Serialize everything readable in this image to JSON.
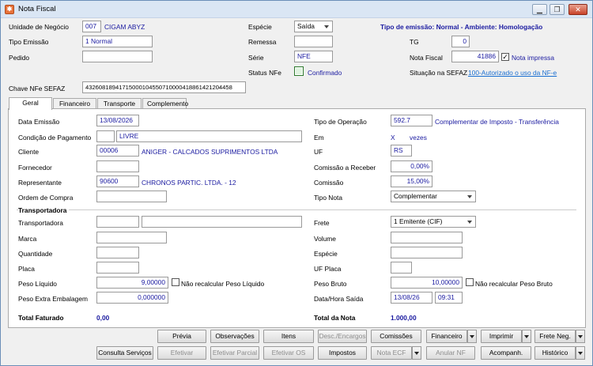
{
  "window": {
    "title": "Nota Fiscal",
    "icon": "app-icon",
    "controls": [
      "minimize",
      "restore",
      "close"
    ]
  },
  "header": {
    "unidade_label": "Unidade de Negócio",
    "unidade_code": "007",
    "unidade_name": "CIGAM ABYZ",
    "especie_label": "Espécie",
    "especie_value": "Saída",
    "tipo_emissao_banner": "Tipo de emissão: Normal - Ambiente: Homologação",
    "tipo_emissao_label": "Tipo Emissão",
    "tipo_emissao_value": "1 Normal",
    "remessa_label": "Remessa",
    "remessa_value": "",
    "tg_label": "TG",
    "tg_value": "0",
    "pedido_label": "Pedido",
    "pedido_value": "",
    "serie_label": "Série",
    "serie_value": "NFE",
    "nota_fiscal_label": "Nota Fiscal",
    "nota_fiscal_value": "41886",
    "nota_impressa_label": "Nota impressa",
    "nota_impressa_checked": true,
    "status_nfe_label": "Status NFe",
    "status_nfe_value": "Confirmado",
    "status_color": "#2e9a2e",
    "situacao_label": "Situação na SEFAZ",
    "situacao_value": "100-Autorizado o uso da NF-e",
    "chave_label": "Chave NFe SEFAZ",
    "chave_value": "43260818941715000104550710000418861421204458"
  },
  "tabs": [
    {
      "label": "Geral",
      "active": true
    },
    {
      "label": "Financeiro",
      "active": false
    },
    {
      "label": "Transporte",
      "active": false
    },
    {
      "label": "Complemento",
      "active": false
    }
  ],
  "geral": {
    "data_emissao_label": "Data Emissão",
    "data_emissao_value": "13/08/2026",
    "tipo_operacao_label": "Tipo de Operação",
    "tipo_operacao_code": "592.7",
    "tipo_operacao_desc": "Complementar de Imposto - Transferência",
    "cond_pag_label": "Condição de Pagamento",
    "cond_pag_code": "",
    "cond_pag_value": "LIVRE",
    "em_label": "Em",
    "em_x": "X",
    "em_vezes": "vezes",
    "cliente_label": "Cliente",
    "cliente_code": "00006",
    "cliente_name": "ANIGER - CALCADOS SUPRIMENTOS LTDA",
    "uf_label": "UF",
    "uf_value": "RS",
    "fornecedor_label": "Fornecedor",
    "fornecedor_value": "",
    "comissao_receber_label": "Comissão a Receber",
    "comissao_receber_value": "0,00%",
    "representante_label": "Representante",
    "representante_code": "90600",
    "representante_name": "CHRONOS PARTIC. LTDA. - 12",
    "comissao_label": "Comissão",
    "comissao_value": "15,00%",
    "ordem_compra_label": "Ordem de Compra",
    "ordem_compra_value": "",
    "tipo_nota_label": "Tipo Nota",
    "tipo_nota_value": "Complementar"
  },
  "transporte": {
    "section_label": "Transportadora",
    "transportadora_label": "Transportadora",
    "transportadora_code": "",
    "transportadora_name": "",
    "frete_label": "Frete",
    "frete_value": "1 Emitente (CIF)",
    "marca_label": "Marca",
    "marca_value": "",
    "volume_label": "Volume",
    "volume_value": "",
    "quantidade_label": "Quantidade",
    "quantidade_value": "",
    "especie_label": "Espécie",
    "especie_value": "",
    "placa_label": "Placa",
    "placa_value": "",
    "uf_placa_label": "UF Placa",
    "uf_placa_value": "",
    "peso_liquido_label": "Peso Líquido",
    "peso_liquido_value": "9,00000",
    "nao_recalc_liq_label": "Não recalcular Peso Líquido",
    "peso_bruto_label": "Peso Bruto",
    "peso_bruto_value": "10,00000",
    "nao_recalc_bruto_label": "Não recalcular Peso Bruto",
    "peso_extra_label": "Peso Extra Embalagem",
    "peso_extra_value": "0,000000",
    "data_hora_saida_label": "Data/Hora Saída",
    "data_saida_value": "13/08/26",
    "hora_saida_value": "09:31"
  },
  "totals": {
    "total_faturado_label": "Total Faturado",
    "total_faturado_value": "0,00",
    "total_nota_label": "Total da Nota",
    "total_nota_value": "1.000,00"
  },
  "buttons_row1": {
    "previa": "Prévia",
    "observacoes": "Observações",
    "itens": "Itens",
    "desc_encargos": "Desc./Encargos",
    "comissoes": "Comissões",
    "financeiro": "Financeiro",
    "imprimir": "Imprimir",
    "frete_neg": "Frete Neg."
  },
  "buttons_row2": {
    "consulta_servicos": "Consulta Serviços",
    "efetivar": "Efetivar",
    "efetivar_parcial": "Efetivar Parcial",
    "efetivar_os": "Efetivar OS",
    "impostos": "Impostos",
    "nota_ecf": "Nota ECF",
    "anular_nf": "Anular NF",
    "acompanh": "Acompanh.",
    "historico": "Histórico"
  }
}
